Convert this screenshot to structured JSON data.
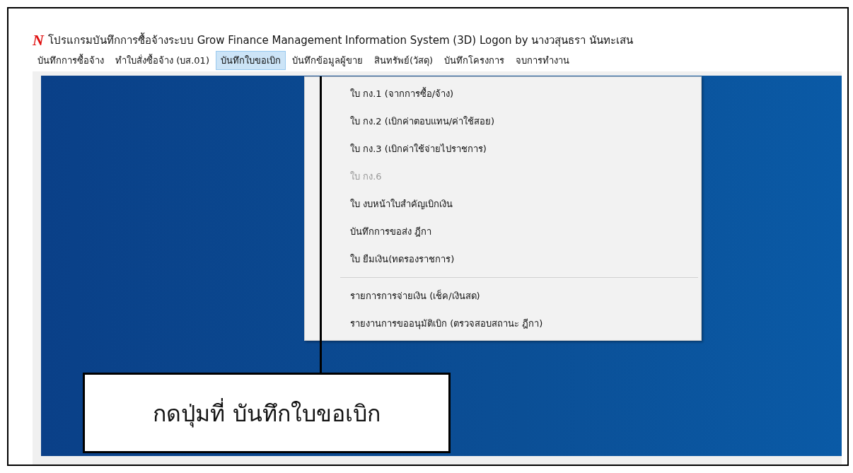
{
  "window": {
    "logo": "N",
    "title": "โปรแกรมบันทึกการซื้อจ้างระบบ  Grow Finance Management Information System (3D) Logon by นางวสุนธรา  นันทะเสน"
  },
  "menu": [
    {
      "label": "บันทึกการซื้อจ้าง",
      "selected": false
    },
    {
      "label": "ทำใบสั่งซื้อจ้าง (บส.01)",
      "selected": false
    },
    {
      "label": "บันทึกใบขอเบิก",
      "selected": true
    },
    {
      "label": "บันทึกข้อมูลผู้ขาย",
      "selected": false
    },
    {
      "label": "สินทรัพย์(วัสดุ)",
      "selected": false
    },
    {
      "label": "บันทึกโครงการ",
      "selected": false
    },
    {
      "label": "จบการทำงาน",
      "selected": false
    }
  ],
  "dropdown": {
    "items": [
      {
        "kind": "item",
        "label": "ใบ กง.1 (จากการซื้อ/จ้าง)",
        "disabled": false
      },
      {
        "kind": "item",
        "label": "ใบ กง.2 (เบิกค่าตอบแทน/ค่าใช้สอย)",
        "disabled": false
      },
      {
        "kind": "item",
        "label": "ใบ กง.3 (เบิกค่าใช้จ่ายไปราชการ)",
        "disabled": false
      },
      {
        "kind": "item",
        "label": "ใบ กง.6",
        "disabled": true
      },
      {
        "kind": "item",
        "label": "ใบ งบหน้าใบสำคัญเบิกเงิน",
        "disabled": false
      },
      {
        "kind": "item",
        "label": "บันทึกการขอส่ง ฎีกา",
        "disabled": false
      },
      {
        "kind": "item",
        "label": "ใบ ยืมเงิน(ทดรองราชการ)",
        "disabled": false
      },
      {
        "kind": "separator"
      },
      {
        "kind": "item",
        "label": "รายการการจ่ายเงิน (เช็ค/เงินสด)",
        "disabled": false
      },
      {
        "kind": "item",
        "label": "รายงานการขออนุมัติเบิก (ตรวจสอบสถานะ ฎีกา)",
        "disabled": false
      }
    ]
  },
  "callout": {
    "text": "กดปุ่มที่ บันทึกใบขอเบิก"
  }
}
